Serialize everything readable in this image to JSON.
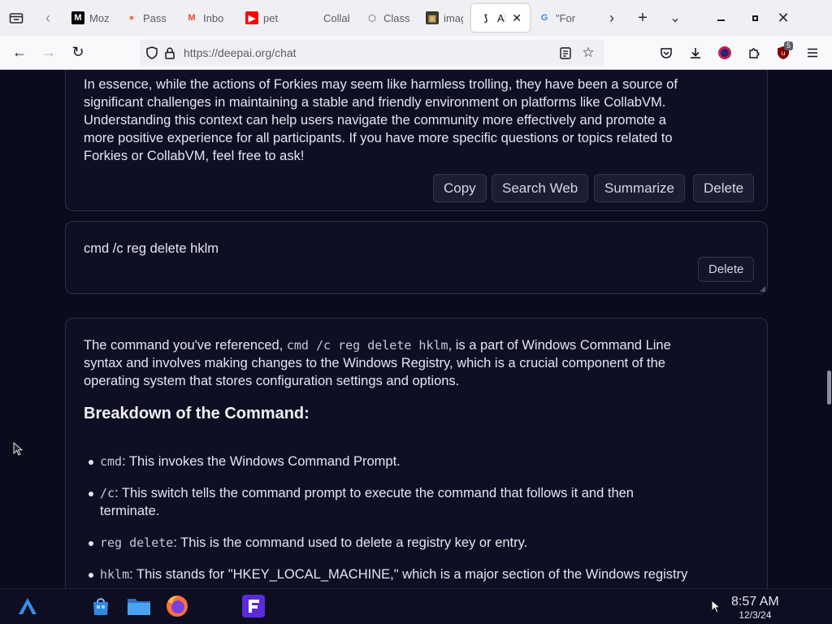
{
  "browser": {
    "tabs": [
      {
        "title": "Moz",
        "favicon": "M",
        "icon": "mozilla-icon",
        "fav_bg": "#000000",
        "fav_fg": "#ffffff"
      },
      {
        "title": "Pass",
        "favicon": "●",
        "icon": "firefox-icon",
        "fav_bg": "transparent",
        "fav_fg": "#ff7139"
      },
      {
        "title": "Inbo",
        "favicon": "M",
        "icon": "gmail-icon",
        "fav_bg": "transparent",
        "fav_fg": "#ea4335"
      },
      {
        "title": "pet",
        "favicon": "▶",
        "icon": "youtube-icon",
        "fav_bg": "#ff0000",
        "fav_fg": "#ffffff"
      },
      {
        "title": "CollabV",
        "favicon": "",
        "icon": "collabvm-icon",
        "fav_bg": "transparent",
        "fav_fg": "#5b5b66"
      },
      {
        "title": "Class",
        "favicon": "⬡",
        "icon": "hexagon-icon",
        "fav_bg": "transparent",
        "fav_fg": "#8f8f9d"
      },
      {
        "title": "imag",
        "favicon": "▣",
        "icon": "image-icon",
        "fav_bg": "#3a3a2a",
        "fav_fg": "#d9b36c"
      },
      {
        "title": "AI",
        "favicon": "⟆",
        "icon": "deepai-icon",
        "fav_bg": "transparent",
        "fav_fg": "#15141a",
        "active": true
      },
      {
        "title": "\"For",
        "favicon": "G",
        "icon": "google-icon",
        "fav_bg": "transparent",
        "fav_fg": "#4285f4"
      }
    ],
    "url": "https://deepai.org/chat"
  },
  "chat": {
    "prev_answer": [
      "In essence, while the actions of Forkies may seem like harmless trolling, they have been a source of",
      "significant challenges in maintaining a stable and friendly environment on platforms like CollabVM.",
      "Understanding this context can help users navigate the community more effectively and promote a",
      "more positive experience for all participants. If you have more specific questions or topics related to",
      "Forkies or CollabVM, feel free to ask!"
    ],
    "actions": {
      "copy": "Copy",
      "search_web": "Search Web",
      "summarize": "Summarize",
      "delete": "Delete"
    },
    "user_message": "cmd /c reg delete hklm",
    "user_delete": "Delete",
    "answer": {
      "intro_before": "The command you've referenced, ",
      "intro_code": "cmd /c reg delete hklm",
      "intro_after": ", is a part of Windows Command Line",
      "intro_line2": "syntax and involves making changes to the Windows Registry, which is a crucial component of the",
      "intro_line3": "operating system that stores configuration settings and options.",
      "heading": "Breakdown of the Command:",
      "bullets": [
        {
          "code": "cmd",
          "text": ": This invokes the Windows Command Prompt.",
          "text2": ""
        },
        {
          "code": "/c",
          "text": ": This switch tells the command prompt to execute the command that follows it and then",
          "text2": "terminate."
        },
        {
          "code": "reg delete",
          "text": ": This is the command used to delete a registry key or entry.",
          "text2": ""
        },
        {
          "code": "hklm",
          "text": ": This stands for \"HKEY_LOCAL_MACHINE,\" which is a major section of the Windows registry",
          "text2": ""
        }
      ]
    }
  },
  "taskbar": {
    "time": "8:57 AM",
    "date": "12/3/24"
  }
}
